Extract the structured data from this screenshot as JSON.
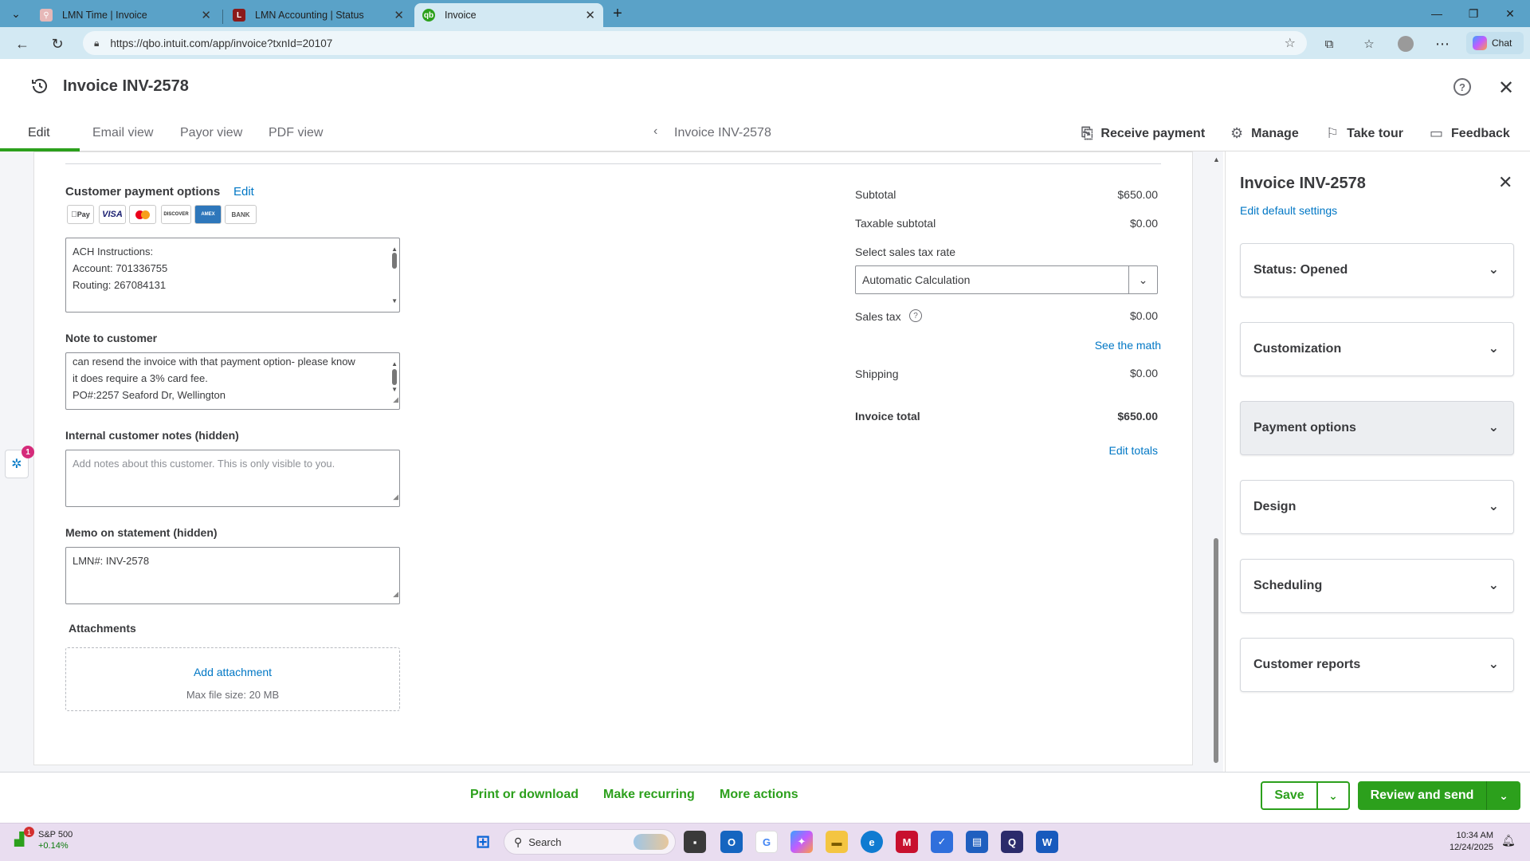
{
  "browser": {
    "tabs": [
      {
        "title": "LMN Time | Invoice",
        "fav_color": "#e6b8b8"
      },
      {
        "title": "LMN Accounting | Status",
        "fav_color": "#8b1a1a"
      },
      {
        "title": "Invoice",
        "fav_color": "#2ca01c"
      }
    ],
    "url": "https://qbo.intuit.com/app/invoice?txnId=20107",
    "chat_label": "Chat"
  },
  "header": {
    "title": "Invoice INV-2578",
    "view_tabs": [
      "Edit",
      "Email view",
      "Payor view",
      "PDF view"
    ],
    "center_title": "Invoice INV-2578",
    "actions": [
      "Receive payment",
      "Manage",
      "Take tour",
      "Feedback"
    ]
  },
  "payment_options": {
    "label": "Customer payment options",
    "edit": "Edit",
    "logos": [
      "Pay",
      "VISA",
      "MC",
      "DISCOVER",
      "AMEX",
      "BANK"
    ],
    "instructions": [
      "ACH Instructions:",
      "Account: 701336755",
      "Routing: 267084131"
    ]
  },
  "note_to_customer": {
    "label": "Note to customer",
    "lines": [
      "can resend the invoice with that payment option- please know",
      "it does require a 3% card fee.",
      "PO#:2257 Seaford Dr, Wellington"
    ]
  },
  "internal_notes": {
    "label": "Internal customer notes (hidden)",
    "placeholder": "Add notes about this customer. This is only visible to you."
  },
  "memo": {
    "label": "Memo on statement (hidden)",
    "value": "LMN#: INV-2578"
  },
  "attachments": {
    "label": "Attachments",
    "add": "Add attachment",
    "max": "Max file size: 20 MB"
  },
  "totals": {
    "subtotal_label": "Subtotal",
    "subtotal": "$650.00",
    "taxable_label": "Taxable subtotal",
    "taxable": "$0.00",
    "rate_label": "Select sales tax rate",
    "rate_value": "Automatic Calculation",
    "tax_label": "Sales tax",
    "tax": "$0.00",
    "see_math": "See the math",
    "shipping_label": "Shipping",
    "shipping": "$0.00",
    "total_label": "Invoice total",
    "total": "$650.00",
    "edit_totals": "Edit totals"
  },
  "sidebar": {
    "title": "Invoice INV-2578",
    "link": "Edit default settings",
    "sections": [
      "Status: Opened",
      "Customization",
      "Payment options",
      "Design",
      "Scheduling",
      "Customer reports"
    ]
  },
  "footer": {
    "actions": [
      "Print or download",
      "Make recurring",
      "More actions"
    ],
    "save": "Save",
    "send": "Review and send"
  },
  "taskbar": {
    "stock_name": "S&P 500",
    "stock_change": "+0.14%",
    "search": "Search",
    "time": "10:34 AM",
    "date": "12/24/2025",
    "badge": "1"
  },
  "widget_badge": "1",
  "colors": {
    "brand_green": "#2ca01c",
    "link_blue": "#0077c5"
  }
}
